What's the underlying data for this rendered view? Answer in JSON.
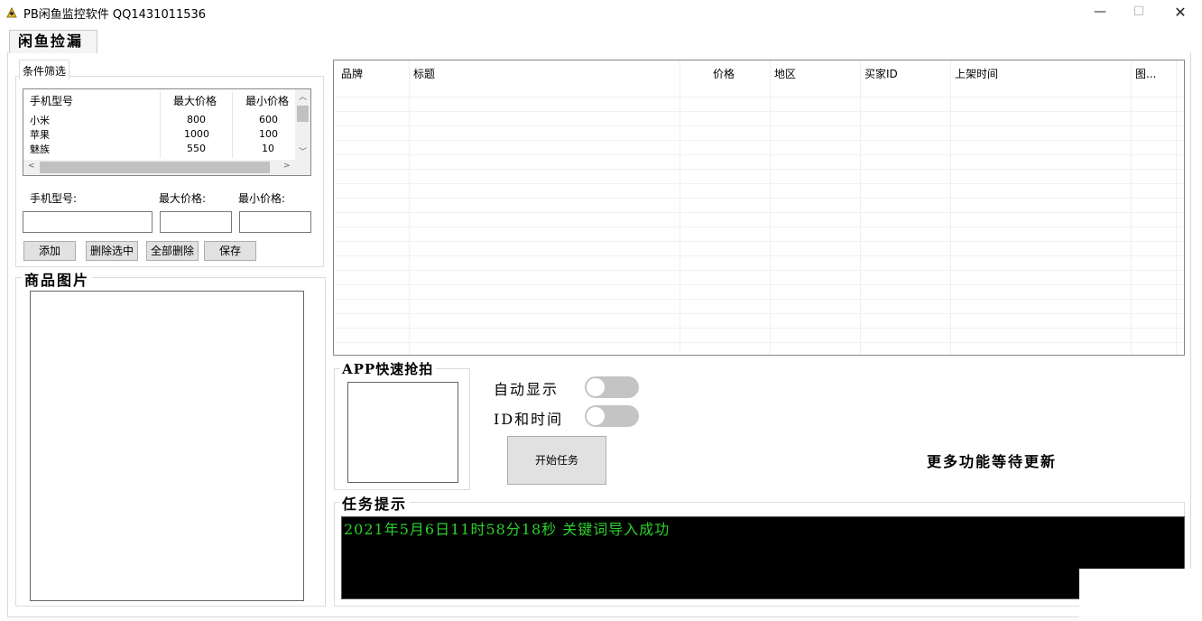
{
  "window": {
    "title": "PB闲鱼监控软件 QQ1431011536",
    "minimize_glyph": "—",
    "maximize_glyph": "☐",
    "close_glyph": "✕"
  },
  "tabs": [
    {
      "label": "闲鱼捡漏",
      "active": true
    }
  ],
  "filter": {
    "group_title": "条件筛选",
    "columns": [
      "手机型号",
      "最大价格",
      "最小价格"
    ],
    "rows": [
      {
        "model": "小米",
        "max": "800",
        "min": "600"
      },
      {
        "model": "苹果",
        "max": "1000",
        "min": "100"
      },
      {
        "model": "魅族",
        "max": "550",
        "min": "10"
      }
    ],
    "model_label": "手机型号:",
    "max_label": "最大价格:",
    "min_label": "最小价格:",
    "model_value": "",
    "max_value": "",
    "min_value": "",
    "buttons": {
      "add": "添加",
      "delete_selected": "删除选中",
      "delete_all": "全部删除",
      "save": "保存"
    }
  },
  "product_image": {
    "title": "商品图片"
  },
  "results": {
    "columns": [
      "品牌",
      "标题",
      "价格",
      "地区",
      "买家ID",
      "上架时间",
      "图..."
    ]
  },
  "app_panel": {
    "title": "APP快速抢拍",
    "auto_show_label": "自动显示",
    "auto_show_on": false,
    "id_time_label": "ID和时间",
    "id_time_on": false,
    "start_button": "开始任务",
    "more_features": "更多功能等待更新"
  },
  "task": {
    "title": "任务提示",
    "log": "2021年5月6日11时58分18秒   关键词导入成功"
  },
  "colors": {
    "console_bg": "#000000",
    "console_text": "#2bd12b",
    "toggle_off": "#c4c4c4"
  }
}
